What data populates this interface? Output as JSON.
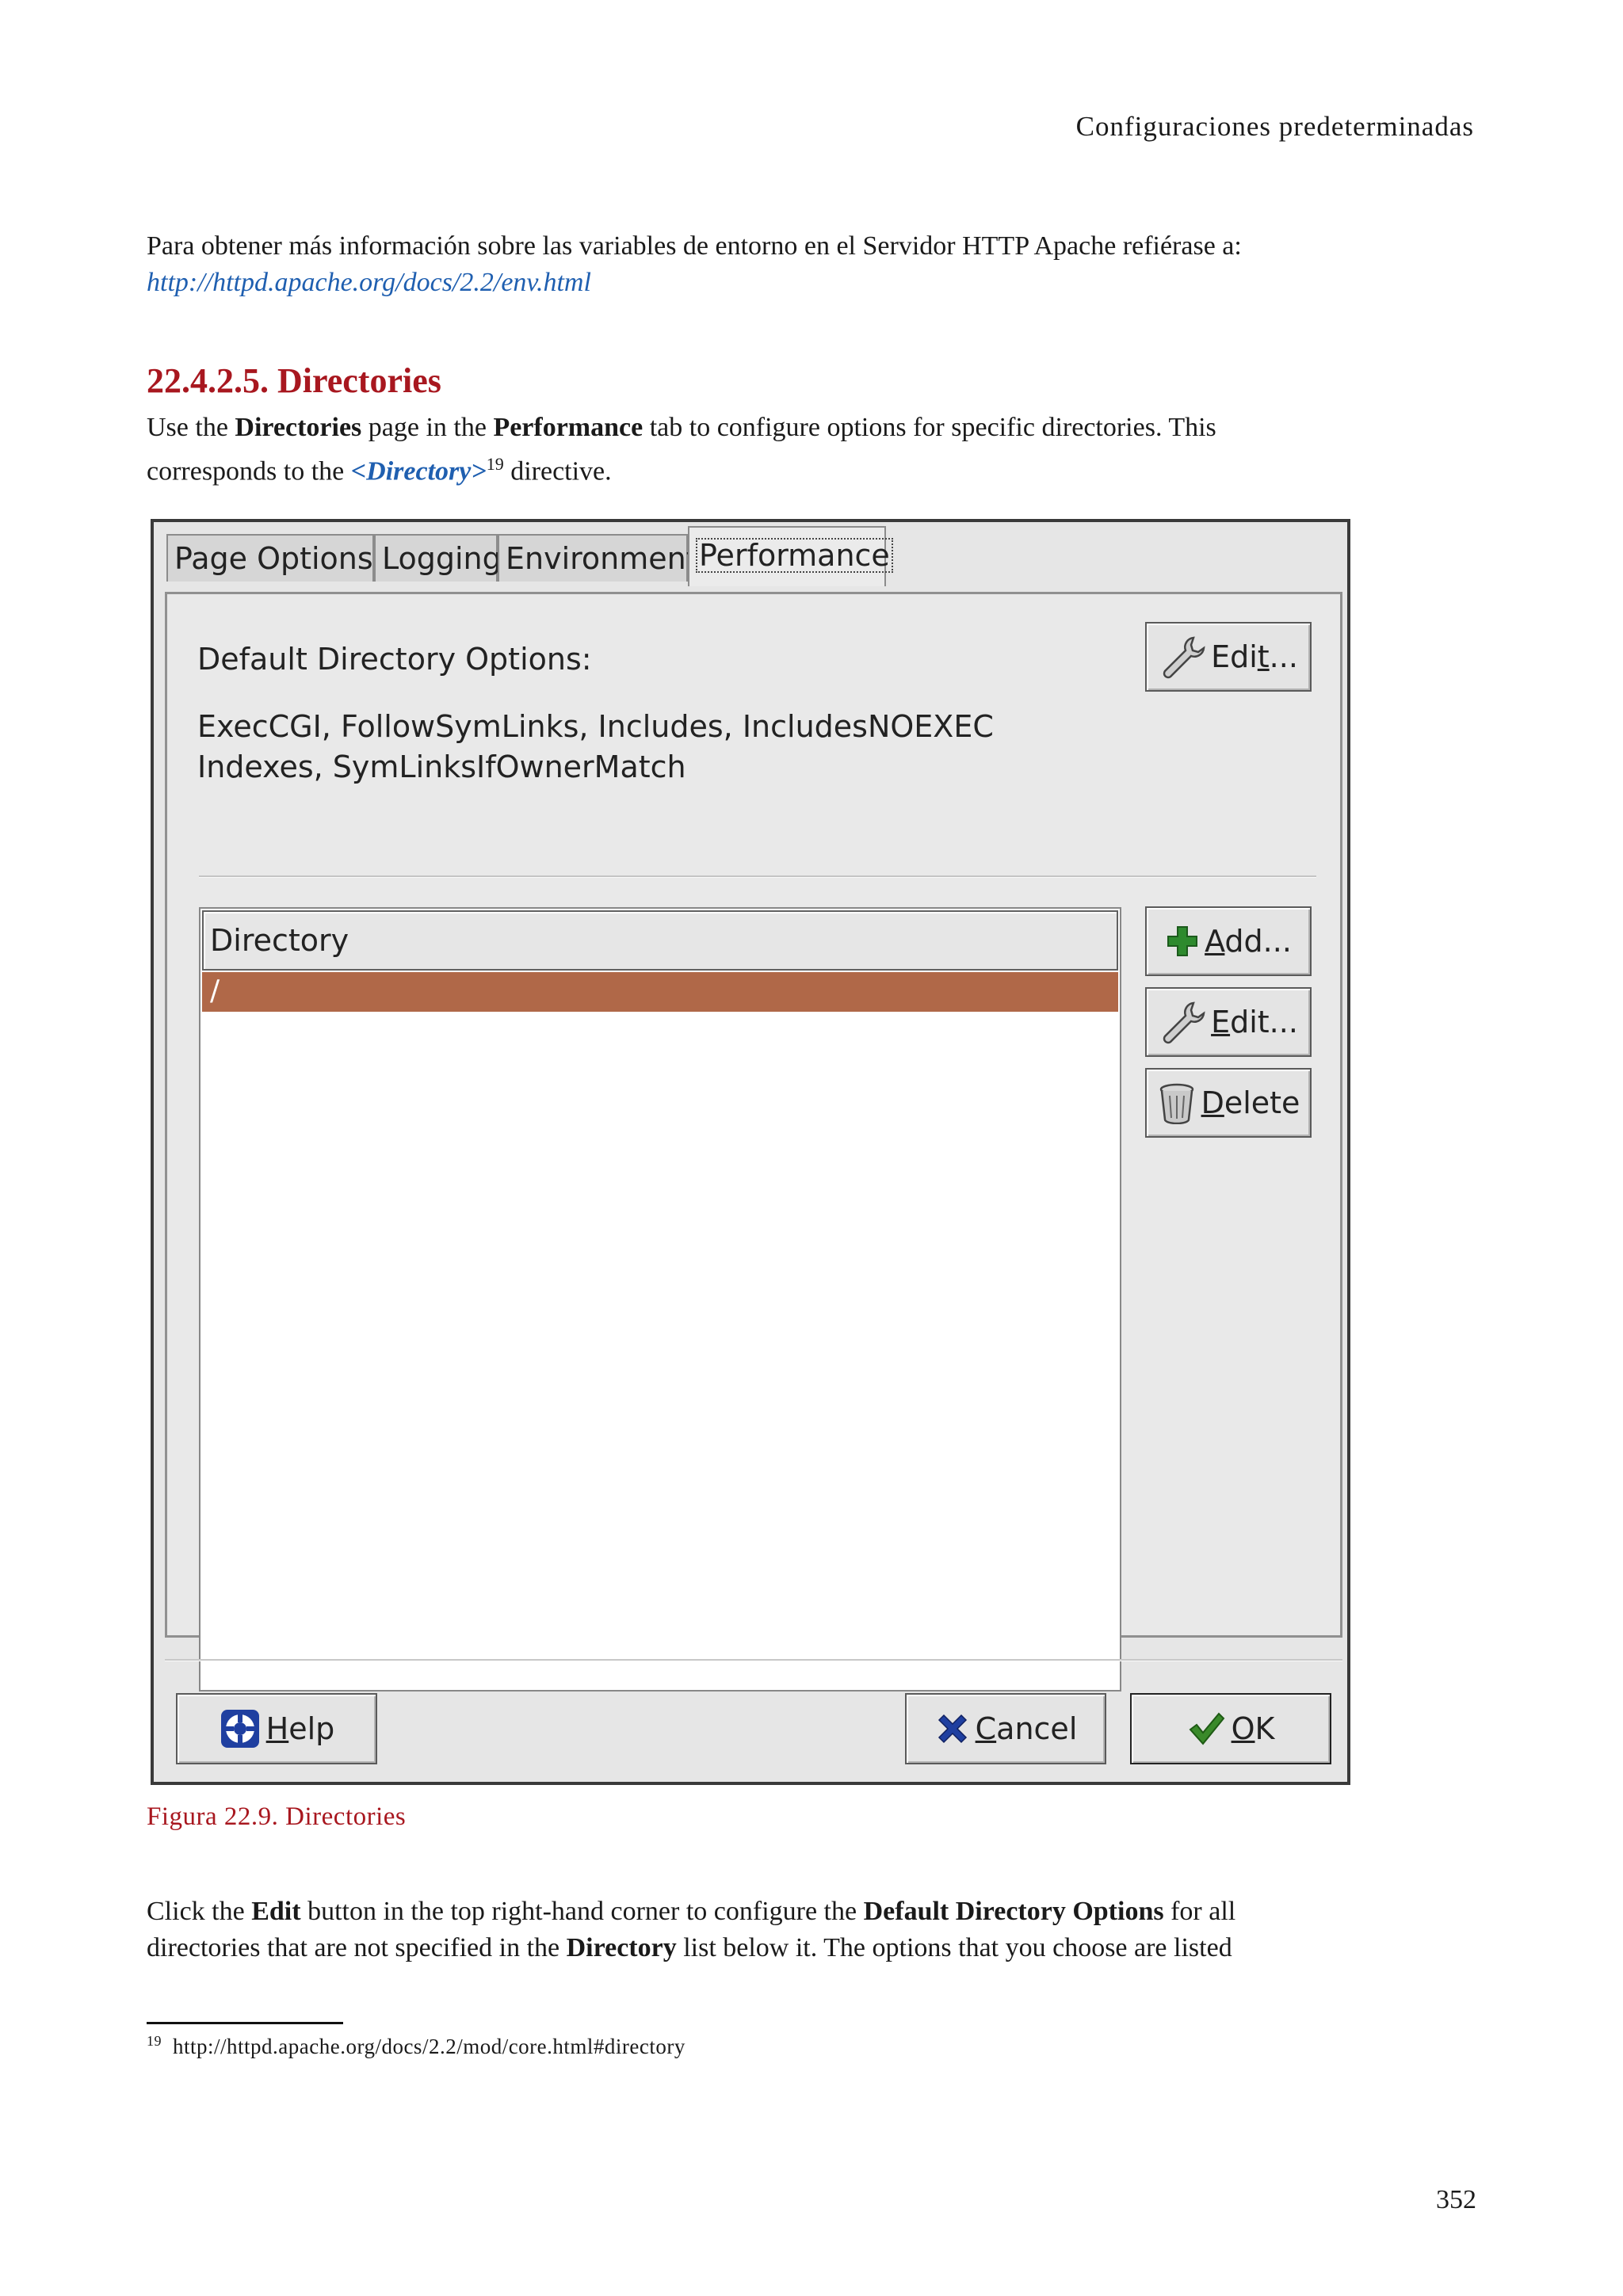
{
  "header": {
    "running_title": "Configuraciones predeterminadas"
  },
  "intro": {
    "text": "Para obtener más información sobre las variables de entorno en el Servidor HTTP Apache refiérase a:",
    "link": "http://httpd.apache.org/docs/2.2/env.html"
  },
  "section": {
    "title": "22.4.2.5. Directories",
    "p1_a": "Use the ",
    "p1_b": "Directories",
    "p1_c": " page in the ",
    "p1_d": "Performance",
    "p1_e": " tab to configure options for specific directories. This",
    "p2_a": "corresponds to the ",
    "p2_link": "<Directory>",
    "p2_sup": "19",
    "p2_b": " directive."
  },
  "dialog": {
    "tabs": [
      "Page Options",
      "Logging",
      "Environment",
      "Performance"
    ],
    "active_tab": "Performance",
    "default_options_label": "Default Directory Options:",
    "options_line1": "ExecCGI, FollowSymLinks, Includes, IncludesNOEXEC",
    "options_line2": "Indexes, SymLinksIfOwnerMatch",
    "edit_top_pre": "Edi",
    "edit_top_u": "t",
    "edit_top_post": "...",
    "list_header": "Directory",
    "list_rows": [
      "/"
    ],
    "add_u": "A",
    "add_post": "dd...",
    "edit_u": "E",
    "edit_post": "dit...",
    "delete_u": "D",
    "delete_post": "elete",
    "help_u": "H",
    "help_post": "elp",
    "cancel_u": "C",
    "cancel_post": "ancel",
    "ok_u": "O",
    "ok_post": "K",
    "colors": {
      "selection": "#b06848",
      "ok_check": "#3a8a2a",
      "cancel_x": "#1f3fa0",
      "add_plus": "#2e8a2e"
    }
  },
  "figure": {
    "caption": "Figura 22.9. Directories"
  },
  "after": {
    "l1_a": "Click the ",
    "l1_b": "Edit",
    "l1_c": " button in the top right-hand corner to configure the ",
    "l1_d": "Default Directory Options",
    "l1_e": " for all",
    "l2_a": "directories that are not specified in the ",
    "l2_b": "Directory",
    "l2_c": " list below it. The options that you choose are listed"
  },
  "footnote": {
    "number": "19",
    "text": "http://httpd.apache.org/docs/2.2/mod/core.html#directory"
  },
  "page_number": "352"
}
